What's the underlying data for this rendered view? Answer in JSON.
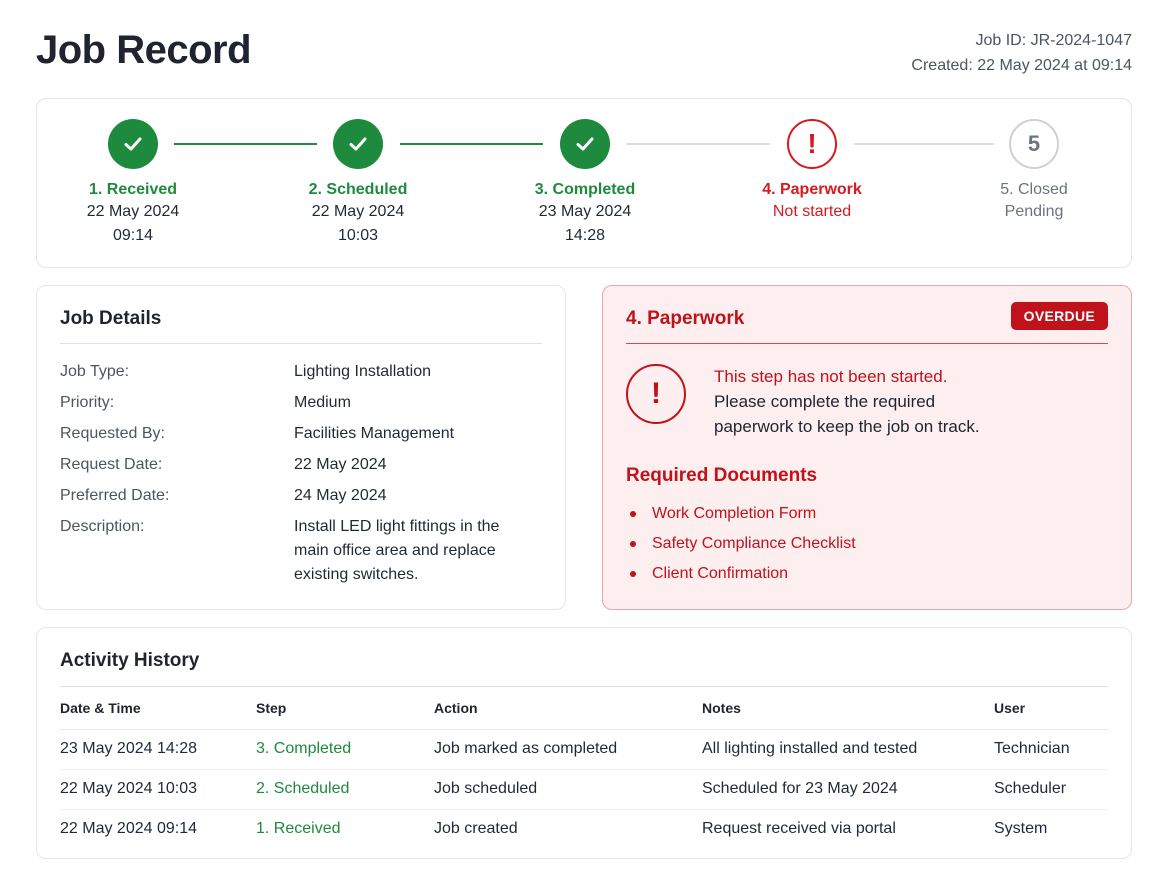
{
  "header": {
    "title": "Job Record",
    "job_id": "Job ID: JR-2024-1047",
    "created": "Created: 22 May 2024 at 09:14"
  },
  "colors": {
    "success": "#1e8a3e",
    "danger": "#c0121a",
    "pending": "#6b7280"
  },
  "stepper": {
    "steps": [
      {
        "label": "1. Received",
        "line1": "22 May 2024",
        "line2": "09:14",
        "status": "done",
        "icon": "check-icon"
      },
      {
        "label": "2. Scheduled",
        "line1": "22 May 2024",
        "line2": "10:03",
        "status": "done",
        "icon": "check-icon"
      },
      {
        "label": "3. Completed",
        "line1": "23 May 2024",
        "line2": "14:28",
        "status": "done",
        "icon": "check-icon"
      },
      {
        "label": "4. Paperwork",
        "line1": "Not started",
        "line2": "",
        "status": "warn",
        "icon": "!"
      },
      {
        "label": "5. Closed",
        "line1": "Pending",
        "line2": "",
        "status": "pending",
        "icon": "5"
      }
    ]
  },
  "details": {
    "title": "Job Details",
    "rows": [
      {
        "key": "Job Type:",
        "value": "Lighting Installation"
      },
      {
        "key": "Priority:",
        "value": "Medium"
      },
      {
        "key": "Requested By:",
        "value": "Facilities Management"
      },
      {
        "key": "Request Date:",
        "value": "22 May 2024"
      },
      {
        "key": "Preferred Date:",
        "value": "24 May 2024"
      },
      {
        "key": "Description:",
        "value": "Install LED light fittings in the main office area and replace existing switches."
      }
    ]
  },
  "paperwork": {
    "title": "4. Paperwork",
    "badge": "OVERDUE",
    "alert_icon": "!",
    "alert_head": "This step has not been started.",
    "alert_body": "Please complete the required paperwork to keep the job on track.",
    "required_title": "Required Documents",
    "documents": [
      "Work Completion Form",
      "Safety Compliance Checklist",
      "Client Confirmation"
    ]
  },
  "activity": {
    "title": "Activity History",
    "columns": [
      "Date & Time",
      "Step",
      "Action",
      "Notes",
      "User"
    ],
    "rows": [
      [
        "23 May 2024 14:28",
        "3. Completed",
        "Job marked as completed",
        "All lighting installed and tested",
        "Technician"
      ],
      [
        "22 May 2024 10:03",
        "2. Scheduled",
        "Job scheduled",
        "Scheduled for 23 May 2024",
        "Scheduler"
      ],
      [
        "22 May 2024 09:14",
        "1. Received",
        "Job created",
        "Request received via portal",
        "System"
      ]
    ]
  }
}
